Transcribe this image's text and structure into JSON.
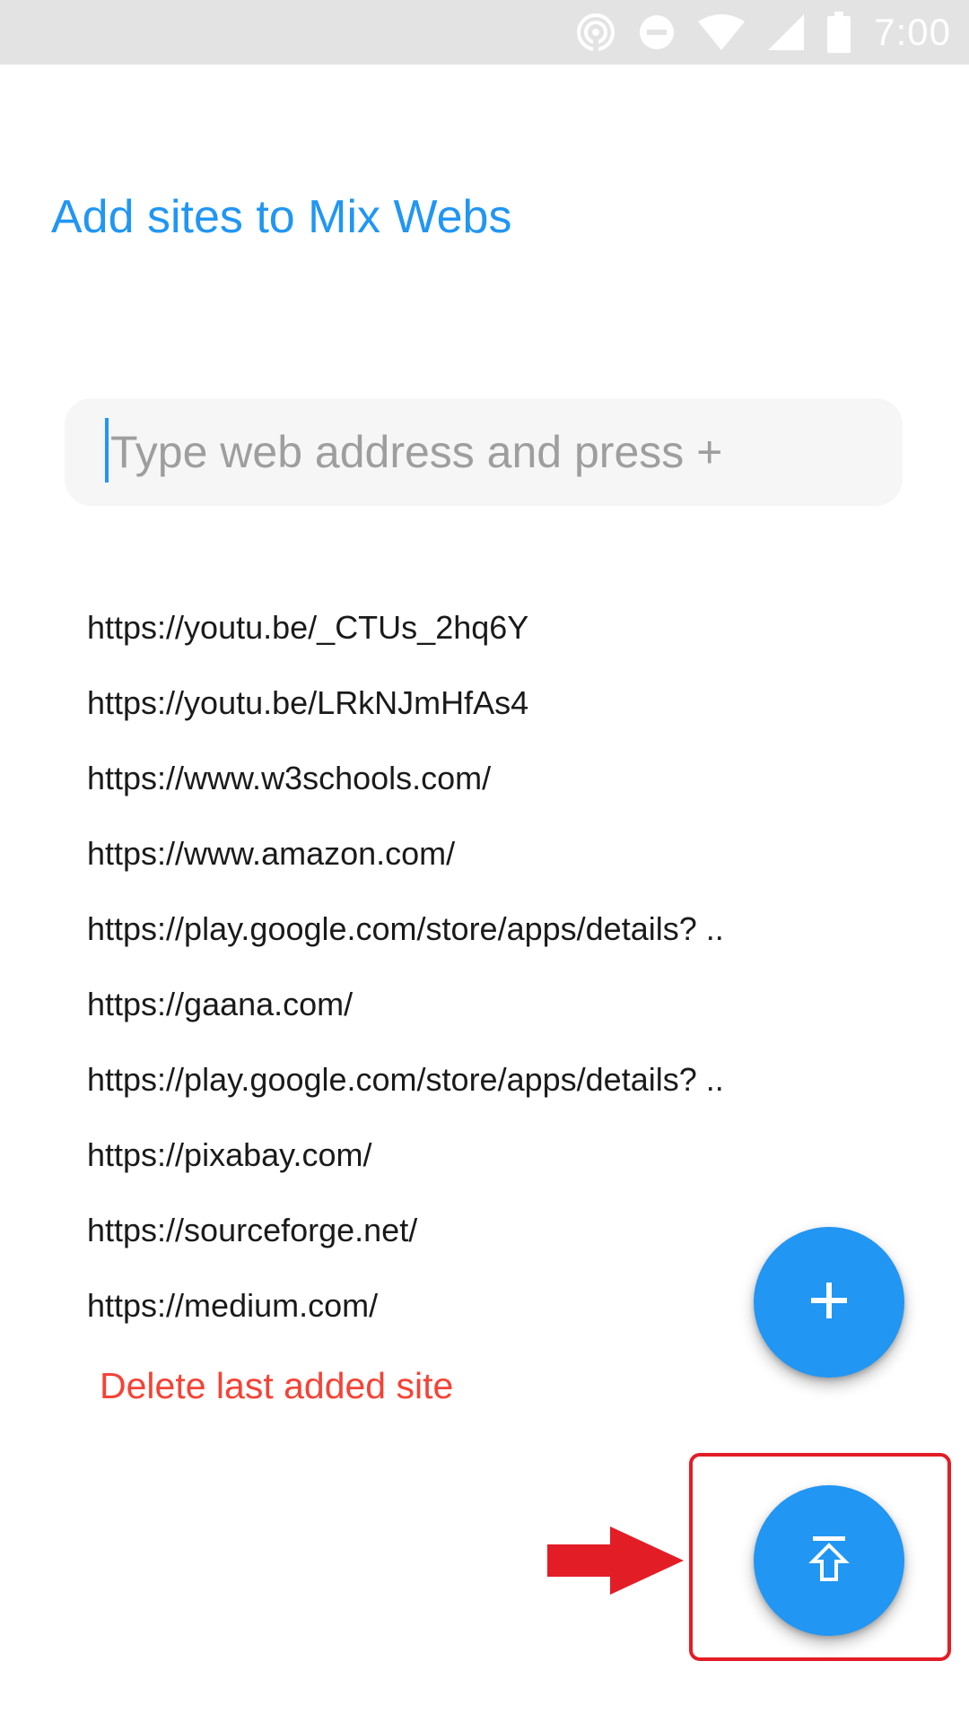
{
  "status_bar": {
    "time": "7:00",
    "icons": [
      "hotspot-icon",
      "do-not-disturb-icon",
      "wifi-icon",
      "signal-icon",
      "battery-icon"
    ]
  },
  "page": {
    "title": "Add sites to Mix Webs"
  },
  "url_input": {
    "placeholder": "Type web address and press +",
    "value": ""
  },
  "sites": [
    "https://youtu.be/_CTUs_2hq6Y",
    "https://youtu.be/LRkNJmHfAs4",
    "https://www.w3schools.com/",
    "https://www.amazon.com/",
    "https://play.google.com/store/apps/details? ..",
    "https://gaana.com/",
    "https://play.google.com/store/apps/details? ..",
    "https://pixabay.com/",
    "https://sourceforge.net/",
    "https://medium.com/"
  ],
  "actions": {
    "delete_label": "Delete last added site",
    "add_icon": "plus-icon",
    "top_icon": "upload-to-top-icon"
  },
  "colors": {
    "accent": "#2196f3",
    "danger": "#f44336",
    "annotation": "#e31d26"
  }
}
